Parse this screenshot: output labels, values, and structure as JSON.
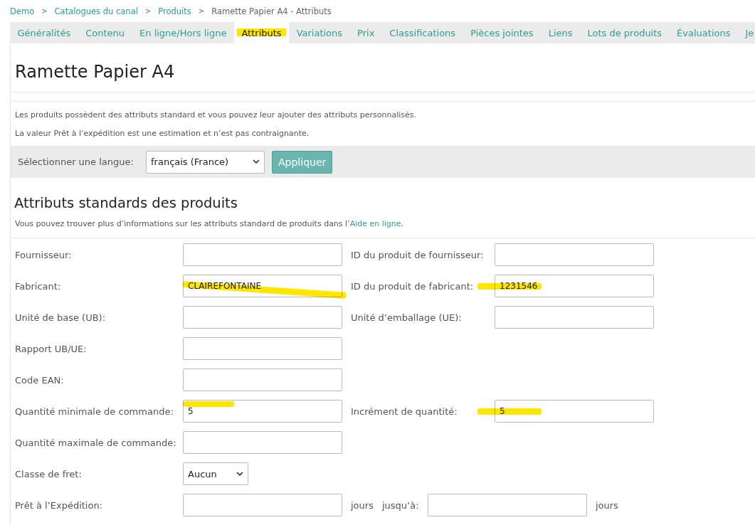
{
  "breadcrumb": [
    {
      "label": "Demo",
      "kind": "link"
    },
    {
      "label": "Catalogues du canal",
      "kind": "link"
    },
    {
      "label": "Produits",
      "kind": "link"
    },
    {
      "label": "Ramette Papier A4 - Attributs",
      "kind": "current"
    }
  ],
  "breadcrumb_separator": ">",
  "tabs": [
    {
      "label": "Généralités",
      "selected": false,
      "highlighted": false
    },
    {
      "label": "Contenu",
      "selected": false,
      "highlighted": false
    },
    {
      "label": "En ligne/Hors ligne",
      "selected": false,
      "highlighted": false
    },
    {
      "label": "Attributs",
      "selected": true,
      "highlighted": true
    },
    {
      "label": "Variations",
      "selected": false,
      "highlighted": false
    },
    {
      "label": "Prix",
      "selected": false,
      "highlighted": false
    },
    {
      "label": "Classifications",
      "selected": false,
      "highlighted": false
    },
    {
      "label": "Pièces jointes",
      "selected": false,
      "highlighted": false
    },
    {
      "label": "Liens",
      "selected": false,
      "highlighted": false
    },
    {
      "label": "Lots de produits",
      "selected": false,
      "highlighted": false
    },
    {
      "label": "Évaluations",
      "selected": false,
      "highlighted": false
    },
    {
      "label": "Je",
      "selected": false,
      "highlighted": false
    }
  ],
  "title": "Ramette Papier A4",
  "intro": [
    "Les produits possèdent des attributs standard et vous pouvez leur ajouter des attributs personnalisés.",
    "La valeur Prêt à l’expédition est une estimation et n’est pas contraignante."
  ],
  "language_bar": {
    "label": "Sélectionner une langue:",
    "value": "français (France)",
    "button": "Appliquer"
  },
  "section": {
    "title": "Attributs standards des produits",
    "help_text": "Vous pouvez trouver plus d’informations sur les attributs standard de produits dans l’",
    "help_link": "Aide en ligne",
    "help_end": "."
  },
  "rows": [
    {
      "label": "Fournisseur:",
      "kind": "text",
      "highlighted": false,
      "side": {
        "label": "ID du produit de fournisseur:",
        "highlighted": false
      }
    },
    {
      "label": "Fabricant:",
      "kind": "text",
      "value": "CLAIREFONTAINE",
      "highlighted": true,
      "side": {
        "label": "ID du produit de fabricant:",
        "value": "1231546",
        "highlighted": true
      }
    },
    {
      "label": "Unité de base (UB):",
      "kind": "text",
      "highlighted": false,
      "side": {
        "label": "Unité d’emballage (UE):",
        "highlighted": false
      }
    },
    {
      "label": "Rapport UB/UE:",
      "kind": "text",
      "highlighted": false
    },
    {
      "label": "Code EAN:",
      "kind": "text",
      "highlighted": false
    },
    {
      "label": "Quantité minimale de commande:",
      "kind": "text",
      "value": "5",
      "highlighted": true,
      "side": {
        "label": "Incrément de quantité:",
        "value": "5",
        "highlighted": true
      }
    },
    {
      "label": "Quantité maximale de commande:",
      "kind": "text",
      "highlighted": false
    },
    {
      "label": "Classe de fret:",
      "kind": "select",
      "value": "Aucun",
      "highlighted": false
    },
    {
      "label": "Prêt à l’Expédition:",
      "kind": "range",
      "highlighted": false,
      "unit": "jours",
      "to_label": "jusqu’à:",
      "unit_end": "jours"
    }
  ]
}
